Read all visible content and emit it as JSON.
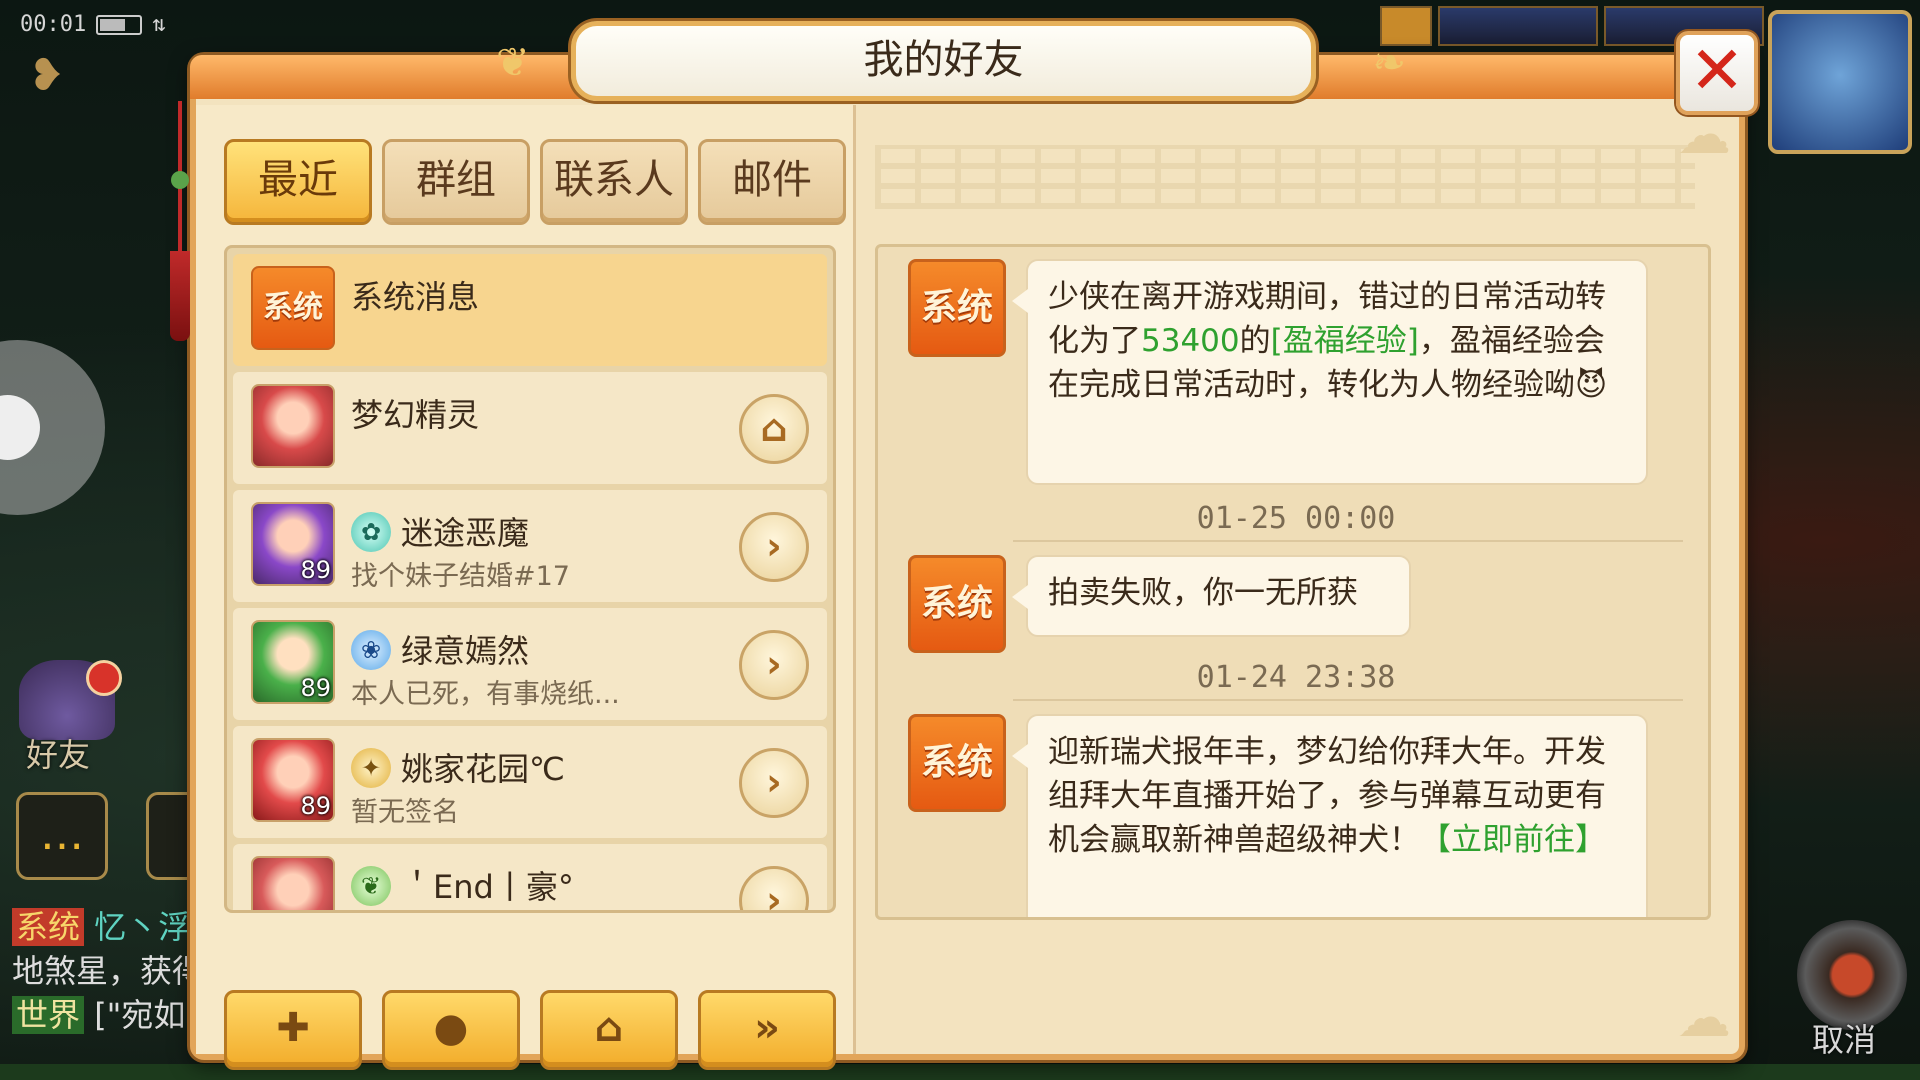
{
  "status": {
    "time": "00:01"
  },
  "hud": {
    "friend_label": "好友",
    "cancel_label": "取消"
  },
  "chat_log": {
    "line1_tag": "系统",
    "line1_text": "忆丶浮",
    "line2_text": "地煞星，获得",
    "line3_tag": "世界",
    "line3_text": "[\"宛如"
  },
  "panel": {
    "title": "我的好友",
    "close_symbol": "✕"
  },
  "tabs": [
    {
      "label": "最近",
      "active": true
    },
    {
      "label": "群组",
      "active": false
    },
    {
      "label": "联系人",
      "active": false
    },
    {
      "label": "邮件",
      "active": false
    }
  ],
  "friends": [
    {
      "name": "系统消息",
      "avatar_text": "系统",
      "signature": "",
      "level": ""
    },
    {
      "name": "梦幻精灵",
      "signature": "",
      "level": "",
      "action_icon": "home-icon"
    },
    {
      "name": "迷途恶魔",
      "signature": "找个妹子结婚#17",
      "level": "89",
      "school_icon": "teal-school-icon"
    },
    {
      "name": "绿意嫣然",
      "signature": "本人已死，有事烧纸...",
      "level": "89",
      "school_icon": "blue-school-icon"
    },
    {
      "name": "姚家花园℃",
      "signature": "暂无签名",
      "level": "89",
      "school_icon": "gold-school-icon"
    },
    {
      "name": "＇End丨豪°",
      "signature": "",
      "level": "",
      "school_icon": "green-school-icon"
    }
  ],
  "action_buttons": [
    {
      "name": "add-friend-button",
      "icon": "add-user-icon"
    },
    {
      "name": "chat-button",
      "icon": "chat-bubble-icon"
    },
    {
      "name": "home-button",
      "icon": "home-icon"
    },
    {
      "name": "more-button",
      "icon": "double-chevron-icon"
    }
  ],
  "messages": [
    {
      "sender": "系统",
      "text_pre": "少侠在离开游戏期间，错过的日常活动转化为了",
      "highlight1": "53400",
      "text_mid": "的",
      "highlight2": "[盈福经验]",
      "text_post": "，盈福经验会在完成日常活动时，转化为人物经验呦"
    },
    {
      "timestamp": "01-25 00:00"
    },
    {
      "sender": "系统",
      "text_pre": "拍卖失败，你一无所获"
    },
    {
      "timestamp": "01-24 23:38"
    },
    {
      "sender": "系统",
      "text_pre": "迎新瑞犬报年丰，梦幻给你拜大年。开发组拜大年直播开始了，参与弹幕互动更有机会赢取新神兽超级神犬！",
      "highlight1": "【立即前往】"
    }
  ],
  "colors": {
    "accent_orange": "#f2ac2a",
    "link_green": "#2fa12f",
    "close_red": "#d4261a"
  }
}
